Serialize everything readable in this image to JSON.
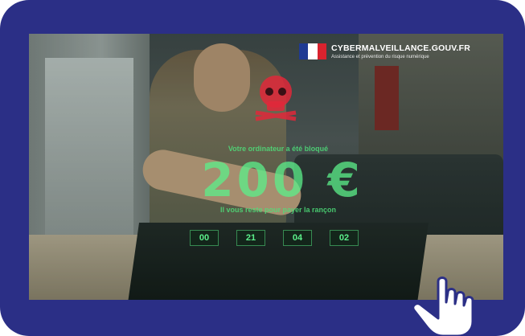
{
  "logo": {
    "title": "CYBERMALVEILLANCE.GOUV.FR",
    "subtitle": "Assistance et prévention du risque numérique"
  },
  "ransom": {
    "top_text": "Votre ordinateur a été bloqué",
    "amount": "200 €",
    "bottom_text": "Il vous reste pour payer la rançon",
    "timers": [
      "00",
      "21",
      "04",
      "02"
    ]
  },
  "colors": {
    "frame": "#2b2f86",
    "ransom_green": "#5cf08a",
    "skull_red": "#e0283a"
  },
  "icons": {
    "skull": "skull-icon",
    "cursor": "hand-pointer-icon",
    "flag": "french-flag-icon"
  }
}
